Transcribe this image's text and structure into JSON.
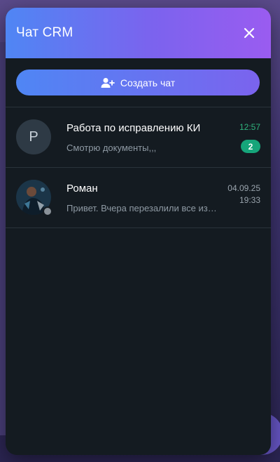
{
  "header": {
    "title": "Чат CRM"
  },
  "toolbar": {
    "create_chat_label": "Создать чат"
  },
  "chats": [
    {
      "avatar_letter": "Р",
      "name": "Работа по исправлению КИ",
      "preview": "Смотрю документы,,,",
      "time": "12:57",
      "unread": "2"
    },
    {
      "name": "Роман",
      "preview": "Привет. Вчера перезалили все изменения",
      "date": "04.09.25",
      "time": "19:33",
      "status": "offline"
    }
  ],
  "colors": {
    "header_gradient_start": "#4f86f4",
    "header_gradient_end": "#9a5cf0",
    "panel_bg": "#141b21",
    "unread_badge": "#16a57a",
    "time_accent": "#2fb37d"
  },
  "icons": {
    "close": "close-icon",
    "create_chat": "user-plus-icon"
  }
}
